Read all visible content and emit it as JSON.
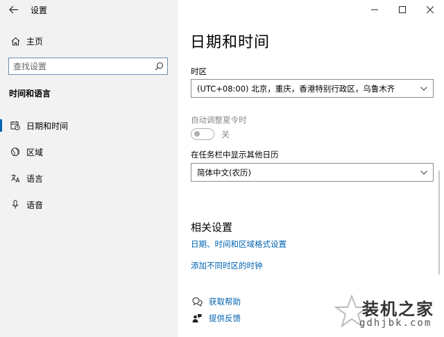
{
  "window": {
    "title": "设置",
    "controls": {
      "minimize": "minimize-icon",
      "maximize": "maximize-icon",
      "close": "close-icon"
    }
  },
  "sidebar": {
    "home": {
      "label": "主页",
      "icon": "home-icon"
    },
    "search": {
      "placeholder": "查找设置",
      "icon": "search-icon"
    },
    "section": "时间和语言",
    "items": [
      {
        "label": "日期和时间",
        "icon": "calendar-clock-icon",
        "active": true
      },
      {
        "label": "区域",
        "icon": "globe-icon",
        "active": false
      },
      {
        "label": "语言",
        "icon": "language-icon",
        "active": false
      },
      {
        "label": "语音",
        "icon": "microphone-icon",
        "active": false
      }
    ]
  },
  "main": {
    "title": "日期和时间",
    "timezone": {
      "label": "时区",
      "value": "(UTC+08:00) 北京，重庆，香港特别行政区，乌鲁木齐"
    },
    "dst": {
      "label": "自动调整夏令时",
      "state": "关"
    },
    "calendar": {
      "label": "在任务栏中显示其他日历",
      "value": "简体中文(农历)"
    },
    "related": {
      "title": "相关设置",
      "links": [
        "日期、时间和区域格式设置",
        "添加不同时区的时钟"
      ]
    },
    "help": [
      {
        "label": "获取帮助",
        "icon": "help-chat-icon"
      },
      {
        "label": "提供反馈",
        "icon": "feedback-icon"
      }
    ]
  },
  "watermark": {
    "text": "装机之家",
    "url": "gdhjbk.com"
  },
  "colors": {
    "accent": "#0063b1",
    "sidebar_bg": "#f2f2f2",
    "disabled": "#8a8a8a"
  }
}
